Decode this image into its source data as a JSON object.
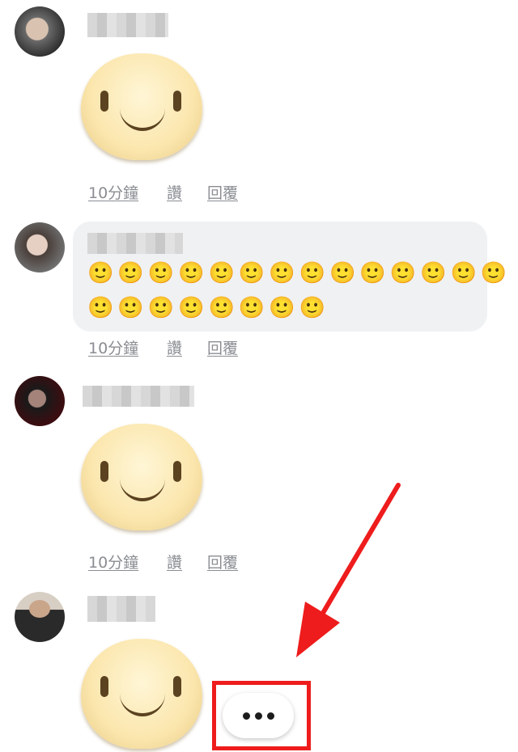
{
  "comments": [
    {
      "type": "sticker",
      "sticker_icon": "smile-sticker-icon",
      "actions": {
        "time": "10分鐘",
        "like": "讚",
        "reply": "回覆"
      }
    },
    {
      "type": "emoji-text",
      "emoji_line_1": "🙂🙂🙂🙂🙂🙂🙂🙂🙂🙂🙂🙂🙂🙂",
      "emoji_line_2": "🙂🙂🙂🙂🙂🙂🙂🙂",
      "actions": {
        "time": "10分鐘",
        "like": "讚",
        "reply": "回覆"
      }
    },
    {
      "type": "sticker",
      "sticker_icon": "smile-sticker-icon",
      "actions": {
        "time": "10分鐘",
        "like": "讚",
        "reply": "回覆"
      }
    },
    {
      "type": "sticker",
      "sticker_icon": "smile-sticker-icon",
      "typing_indicator_icon": "ellipsis-icon"
    }
  ],
  "annotation": {
    "color": "#ee1c1c",
    "shapes": [
      "arrow",
      "rectangle"
    ]
  },
  "colors": {
    "bubble": "#f0f1f3",
    "action_text": "#8a8d92",
    "background": "#ffffff"
  }
}
